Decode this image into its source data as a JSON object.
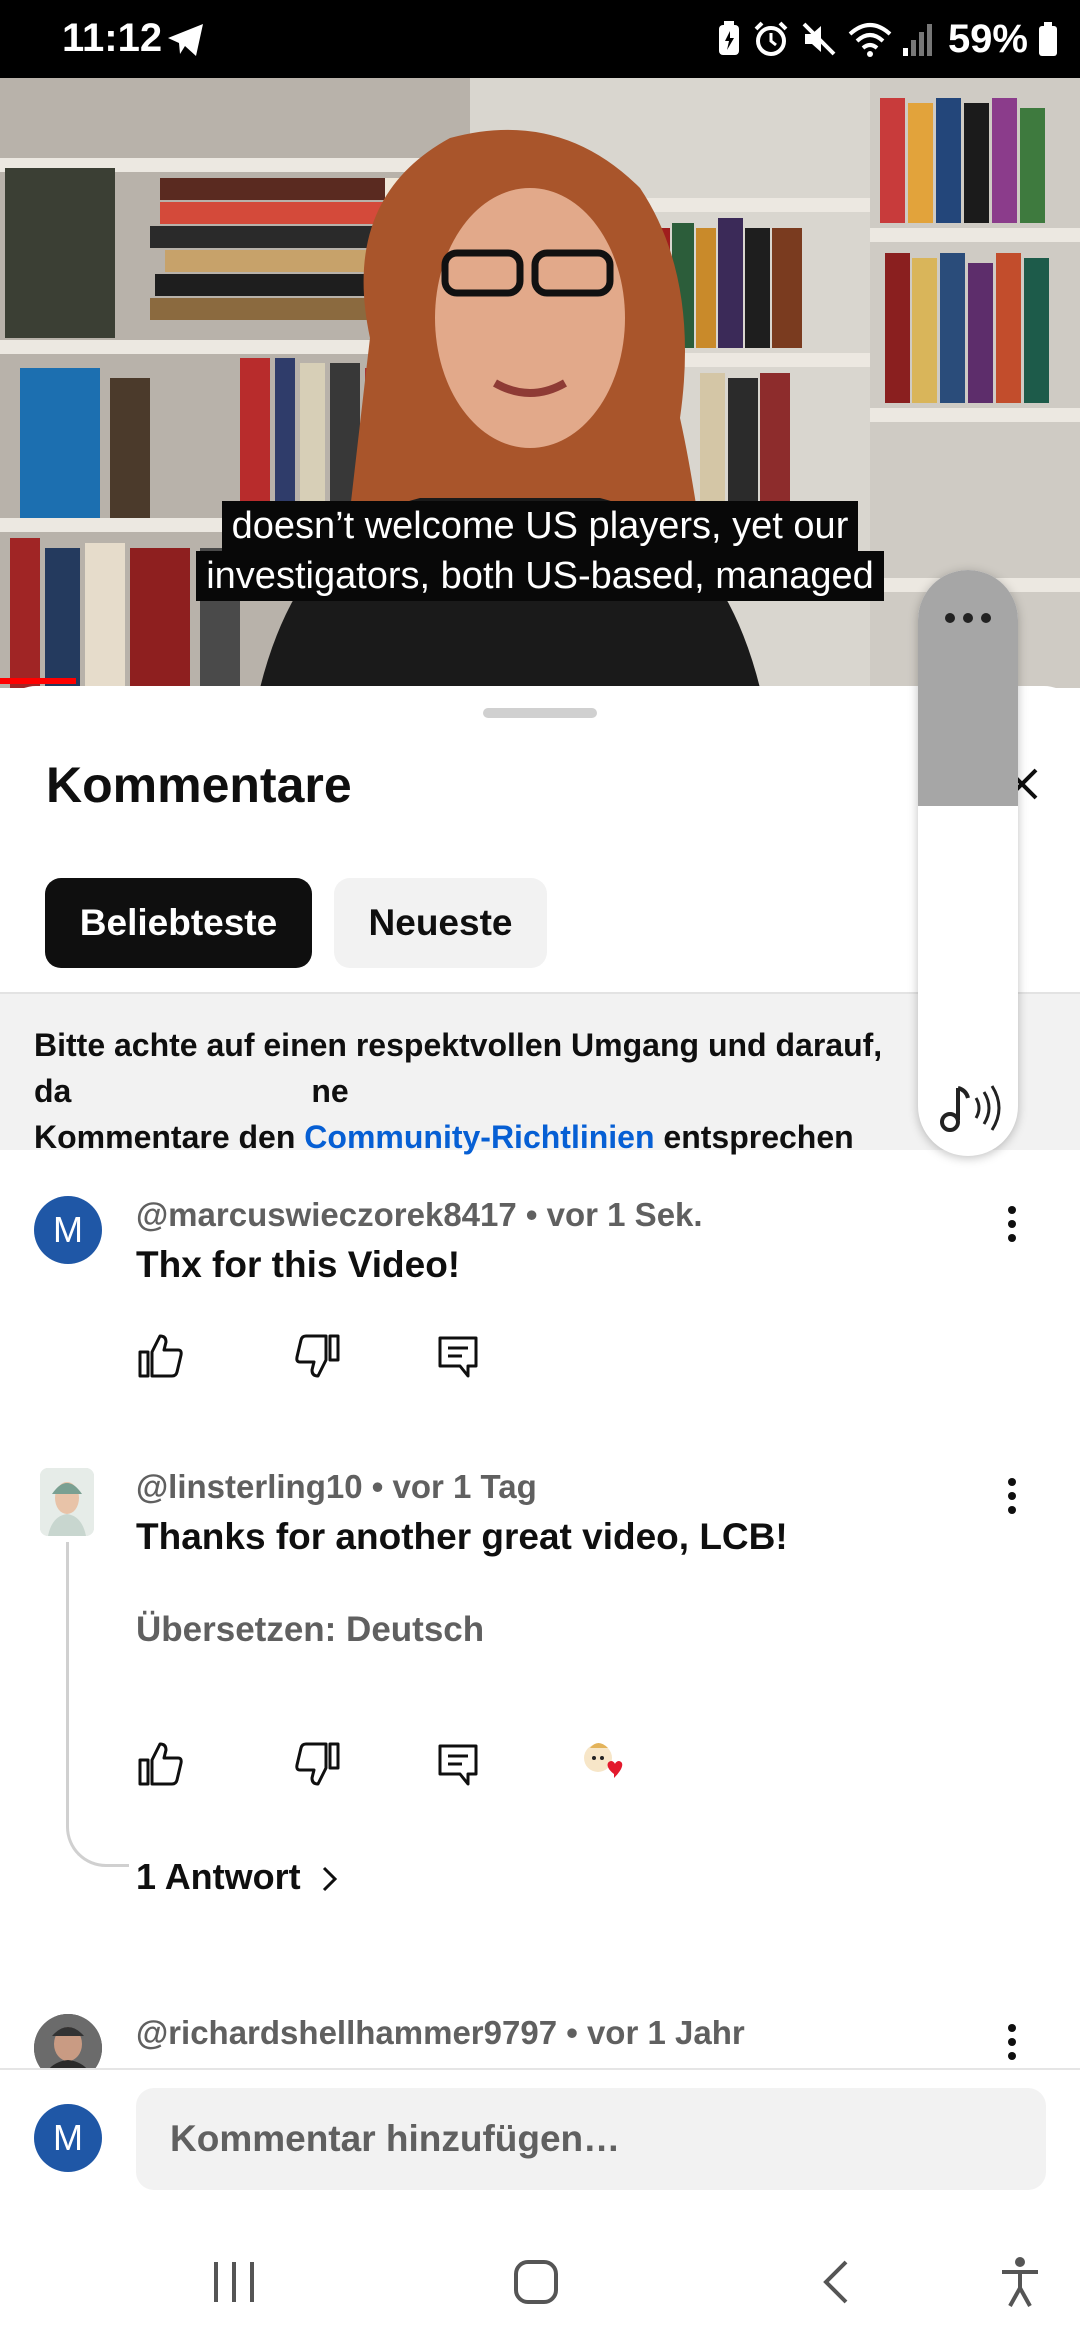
{
  "status_bar": {
    "time": "11:12",
    "battery": "59%"
  },
  "video": {
    "subtitle_line1": "doesn’t welcome US players, yet our",
    "subtitle_line2": "investigators, both US-based, managed",
    "progress": 0.07
  },
  "sheet": {
    "title": "Kommentare",
    "tabs": [
      {
        "label": "Beliebteste",
        "active": true
      },
      {
        "label": "Neueste",
        "active": false
      }
    ],
    "notice": {
      "text_before": "Bitte achte auf einen respektvollen Umgang und darauf, da",
      "text_hidden_end": "ne",
      "text_line2_before": "Kommentare den ",
      "link": "Community-Richtlinien",
      "text_after": " entsprechen"
    }
  },
  "comments": [
    {
      "author": "@marcuswieczorek8417",
      "time": "• vor 1 Sek.",
      "avatar_letter": "M",
      "text": "Thx for this Video!"
    },
    {
      "author": "@linsterling10",
      "time": "• vor 1 Tag",
      "text": "Thanks for another great video, LCB!",
      "translate": "Übersetzen: Deutsch",
      "replies": "1 Antwort"
    },
    {
      "author": "@richardshellhammer9797",
      "time": "• vor 1 Jahr"
    }
  ],
  "composer": {
    "avatar_letter": "M",
    "placeholder": "Kommentar hinzufügen…"
  },
  "colors": {
    "accent_red": "#ff0000",
    "link_blue": "#065fd4",
    "avatar_blue": "#1f57a6"
  },
  "icons": [
    "telegram-icon",
    "battery-saver-icon",
    "alarm-icon",
    "mute-icon",
    "wifi-icon",
    "signal-icon",
    "battery-icon",
    "close-icon",
    "like-icon",
    "dislike-icon",
    "reply-icon",
    "more-vert-icon",
    "heart-icon",
    "chevron-right-icon",
    "recents-icon",
    "home-icon",
    "back-icon",
    "accessibility-icon",
    "music-note-icon"
  ]
}
